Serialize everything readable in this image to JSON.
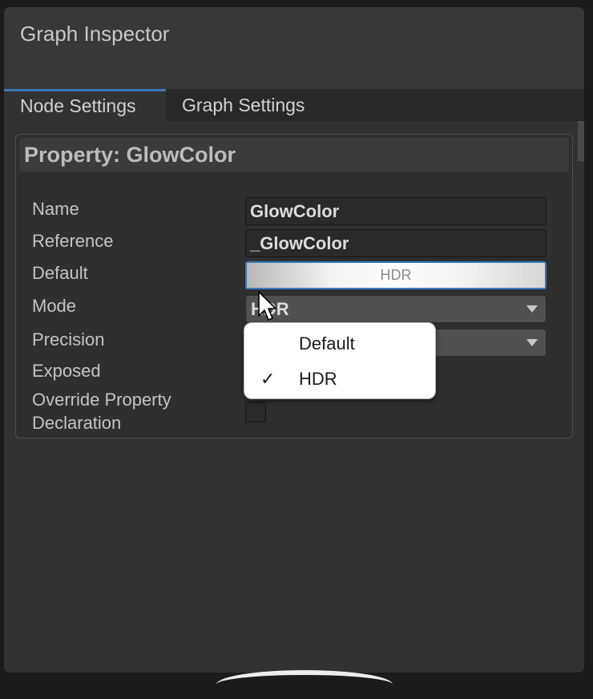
{
  "window": {
    "title": "Graph Inspector"
  },
  "tabs": [
    {
      "label": "Node Settings",
      "active": true
    },
    {
      "label": "Graph Settings",
      "active": false
    }
  ],
  "panel": {
    "title": "Property: GlowColor",
    "rows": {
      "name": {
        "label": "Name",
        "value": "GlowColor"
      },
      "reference": {
        "label": "Reference",
        "value": "_GlowColor"
      },
      "default": {
        "label": "Default",
        "badge": "HDR"
      },
      "mode": {
        "label": "Mode",
        "value": "HDR"
      },
      "precision": {
        "label": "Precision",
        "value": ""
      },
      "exposed": {
        "label": "Exposed"
      },
      "override": {
        "label_line1": "Override Property",
        "label_line2": "Declaration",
        "checked": false
      }
    }
  },
  "mode_popup": {
    "options": [
      {
        "label": "Default",
        "checked": false
      },
      {
        "label": "HDR",
        "checked": true
      }
    ],
    "check_glyph": "✓"
  },
  "colors": {
    "accent": "#3a79bb",
    "panel_bg": "#323232",
    "text": "#c4c4c4"
  }
}
